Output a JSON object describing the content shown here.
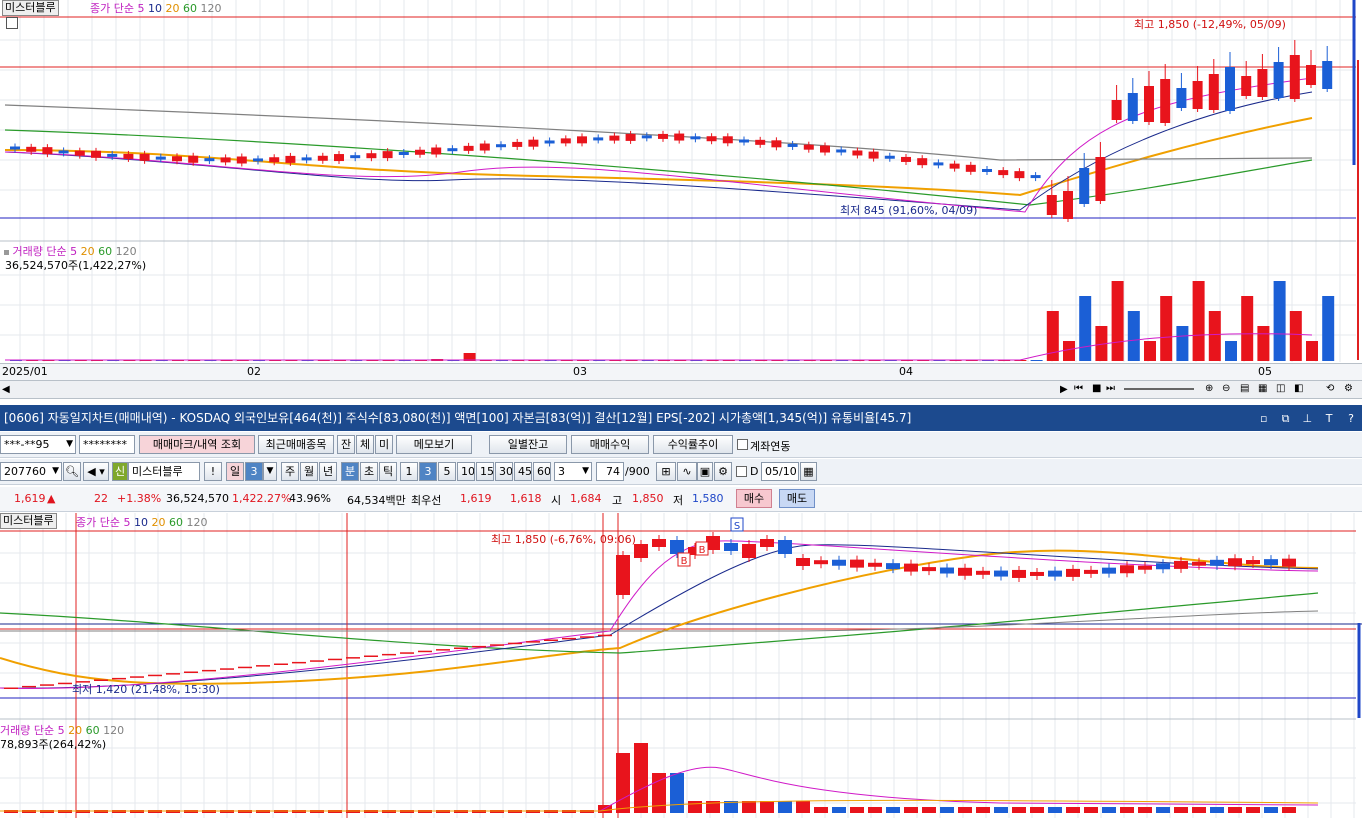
{
  "top_chart": {
    "name_button": "미스터블루",
    "price_legend": {
      "label": "종가 단순",
      "periods": [
        "5",
        "10",
        "20",
        "60",
        "120"
      ]
    },
    "high_label": "최고 1,850 (-12,49%, 05/09)",
    "low_label": "최저 845 (91,60%, 04/09)",
    "volume_legend": {
      "label": "거래량 단순",
      "periods": [
        "5",
        "20",
        "60",
        "120"
      ]
    },
    "volume_value": "36,524,570주(1,422,27%)",
    "x_labels": [
      "2025/01",
      "02",
      "03",
      "04",
      "05"
    ]
  },
  "window_title": "[0606] 자동일지차트(매매내역) - KOSDAQ 외국인보유[464(천)] 주식수[83,080(천)] 액면[100] 자본금[83(억)] 결산[12월] EPS[-202] 시가총액[1,345(억)] 유통비율[45.7]",
  "toolbar1": {
    "account": "***-**95",
    "password": "********",
    "trade_mark_button": "매매마크/내역 조회",
    "recent_button": "최근매매종목",
    "tab_jan": "잔",
    "tab_che": "체",
    "tab_mi": "미",
    "memo_button": "메모보기",
    "daily_balance_button": "일별잔고",
    "profit_button": "매매수익",
    "profit_trend_button": "수익률추이",
    "account_link_label": "계좌연동"
  },
  "toolbar2": {
    "code": "207760",
    "sin_badge": "신",
    "stock_name": "미스터블루",
    "excl": "!",
    "day": "일",
    "day_count": "3",
    "periods": [
      "주",
      "월",
      "년"
    ],
    "bun": "분",
    "cho": "초",
    "tick": "틱",
    "minutes": [
      "1",
      "3",
      "5",
      "10",
      "15",
      "30",
      "45",
      "60"
    ],
    "minute_selected": "3",
    "interval_value": "3",
    "count": "74",
    "count_total": "/900",
    "d_label": "D",
    "date": "05/10"
  },
  "quote": {
    "price": "1,619",
    "arrow": "▲",
    "change": "22",
    "change_pct": "+1.38%",
    "volume": "36,524,570",
    "volume_pct": "1,422.27%",
    "turnover": "43.96%",
    "amount": "64,534백만",
    "best_bid_label": "최우선",
    "best_ask": "1,619",
    "best_bid": "1,618",
    "open_label": "시",
    "open": "1,684",
    "high_label": "고",
    "high": "1,850",
    "low_label": "저",
    "low": "1,580",
    "buy_button": "매수",
    "sell_button": "매도"
  },
  "bottom_chart": {
    "name_button": "미스터블루",
    "price_legend": {
      "label": "종가 단순",
      "periods": [
        "5",
        "10",
        "20",
        "60",
        "120"
      ]
    },
    "high_label": "최고 1,850 (-6,76%, 09:06)",
    "low_label": "최저 1,420 (21,48%, 15:30)",
    "volume_legend": {
      "label": "거래량 단순",
      "periods": [
        "5",
        "20",
        "60",
        "120"
      ]
    },
    "volume_value": "78,893주(264,42%)",
    "markers": [
      "B",
      "B",
      "S"
    ]
  },
  "colors": {
    "up": "#e8141c",
    "down": "#1b5fd6",
    "ma5": "#d01ac8",
    "ma10": "#1a2a8c",
    "ma20": "#f0a000",
    "ma60": "#2a9a2a",
    "ma120": "#808080",
    "titlebar": "#1c4a8e"
  }
}
